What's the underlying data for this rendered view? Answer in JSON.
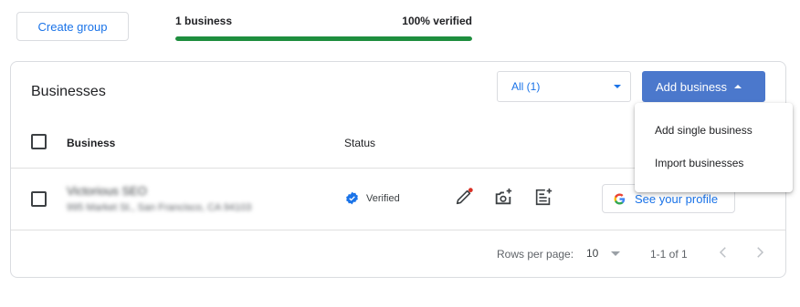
{
  "toolbar": {
    "create_group_label": "Create group",
    "summary_count": "1 business",
    "summary_verified": "100% verified",
    "verified_progress": 1.0
  },
  "card": {
    "title": "Businesses",
    "filter_label": "All (1)",
    "add_business_label": "Add business"
  },
  "table": {
    "columns": {
      "business": "Business",
      "status": "Status"
    },
    "rows": [
      {
        "name": "Victorious SEO",
        "address": "995 Market St., San Francisco, CA 94103",
        "status": "Verified",
        "profile_label": "See your profile"
      }
    ]
  },
  "pager": {
    "rows_per_page_label": "Rows per page:",
    "rows_per_page_value": "10",
    "range": "1-1 of 1"
  },
  "menu": {
    "items": [
      "Add single business",
      "Import businesses"
    ]
  },
  "colors": {
    "accent": "#1a73e8",
    "primary_button": "#4b78cc",
    "progress": "#1e8e3e",
    "notification_dot": "#d93025"
  }
}
